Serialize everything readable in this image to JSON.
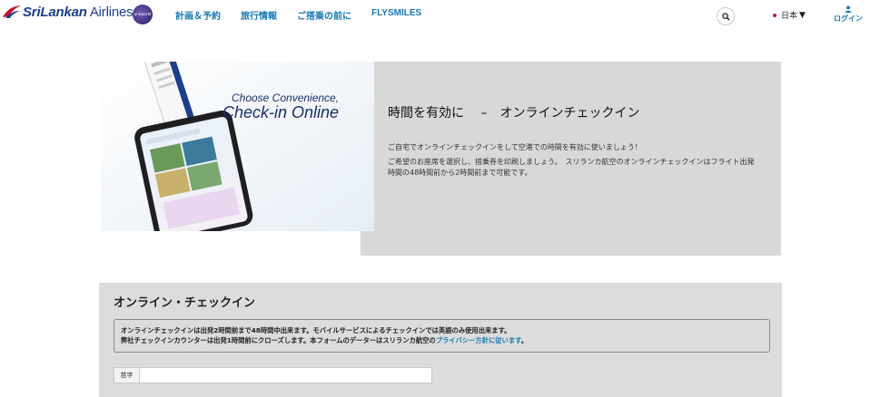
{
  "header": {
    "logo_text_brand": "SriLankan",
    "logo_text_rest": " Airlines",
    "oneworld_text": "oneworld",
    "nav": [
      {
        "label": "計画＆予約"
      },
      {
        "label": "旅行情報"
      },
      {
        "label": "ご搭乗の前に"
      },
      {
        "label": "FLYSMILES"
      }
    ],
    "language": "日本",
    "language_caret": "▼",
    "login_label": "ログイン"
  },
  "hero": {
    "image_caption_line1": "Choose Convenience,",
    "image_caption_line2": "Check-in Online",
    "title": "時間を有効に　 –　オンラインチェックイン",
    "paragraph1": "ご自宅でオンラインチェックインをして空港での時間を有効に使いましょう！",
    "paragraph2": "ご希望のお座席を選択し、搭乗券を印刷しましょう。　スリランカ航空のオンラインチェックインはフライト出発時間の48時間前から2時間前まで可能です。"
  },
  "checkin": {
    "title": "オンライン・チェックイン",
    "notice_line1": "オンラインチェックインは出発2時間前まで48時間中出来ます。モバイルサービスによるチェックインでは英語のみ使用出来ます。",
    "notice_line2_prefix": "弊社チェックインカウンターは出発1時間前にクローズします。本フォームのデーターはスリランカ航空の",
    "notice_link": "プライバシー方針に従います",
    "notice_line2_suffix": "。",
    "surname_label": "苗字",
    "surname_value": ""
  },
  "colors": {
    "brand_blue": "#1b3f8b",
    "link_blue": "#1679b3",
    "panel_gray": "#d8d8d8"
  }
}
